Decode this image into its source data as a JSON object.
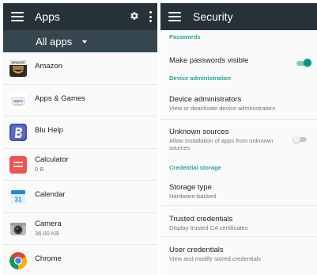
{
  "apps_screen": {
    "title": "Apps",
    "filter_label": "All apps",
    "apps": [
      {
        "name": "Amazon",
        "size": "",
        "icon": "amazon-icon"
      },
      {
        "name": "Apps & Games",
        "size": "",
        "icon": "apps-games-icon"
      },
      {
        "name": "Blu Help",
        "size": "",
        "icon": "blu-help-icon"
      },
      {
        "name": "Calculator",
        "size": "0 B",
        "icon": "calculator-icon"
      },
      {
        "name": "Calendar",
        "size": "",
        "icon": "calendar-icon"
      },
      {
        "name": "Camera",
        "size": "36.00 KB",
        "icon": "camera-icon"
      },
      {
        "name": "Chrome",
        "size": "",
        "icon": "chrome-icon"
      }
    ],
    "calendar_icon_day": "31",
    "amazon_icon_text": "amazon",
    "apps_games_icon_text": "apps"
  },
  "security_screen": {
    "title": "Security",
    "sections": {
      "passwords": "Passwords",
      "device_admin": "Device administration",
      "credential_storage": "Credential storage"
    },
    "items": {
      "make_passwords_visible": {
        "title": "Make passwords visible",
        "enabled": true
      },
      "device_administrators": {
        "title": "Device administrators",
        "subtitle": "View or deactivate device administrators"
      },
      "unknown_sources": {
        "title": "Unknown sources",
        "subtitle": "Allow installation of apps from unknown sources",
        "enabled": false
      },
      "storage_type": {
        "title": "Storage type",
        "subtitle": "Hardware-backed"
      },
      "trusted_credentials": {
        "title": "Trusted credentials",
        "subtitle": "Display trusted CA certificates"
      },
      "user_credentials": {
        "title": "User credentials",
        "subtitle": "View and modify stored credentials"
      }
    }
  },
  "colors": {
    "toolbar": "#263238",
    "subbar": "#37474f",
    "accent": "#26a69a",
    "toggle_on_track": "#80cbc4",
    "toggle_on_thumb": "#009688",
    "toggle_off_track": "#c8c8c8",
    "toggle_off_thumb": "#f1f1f1"
  }
}
